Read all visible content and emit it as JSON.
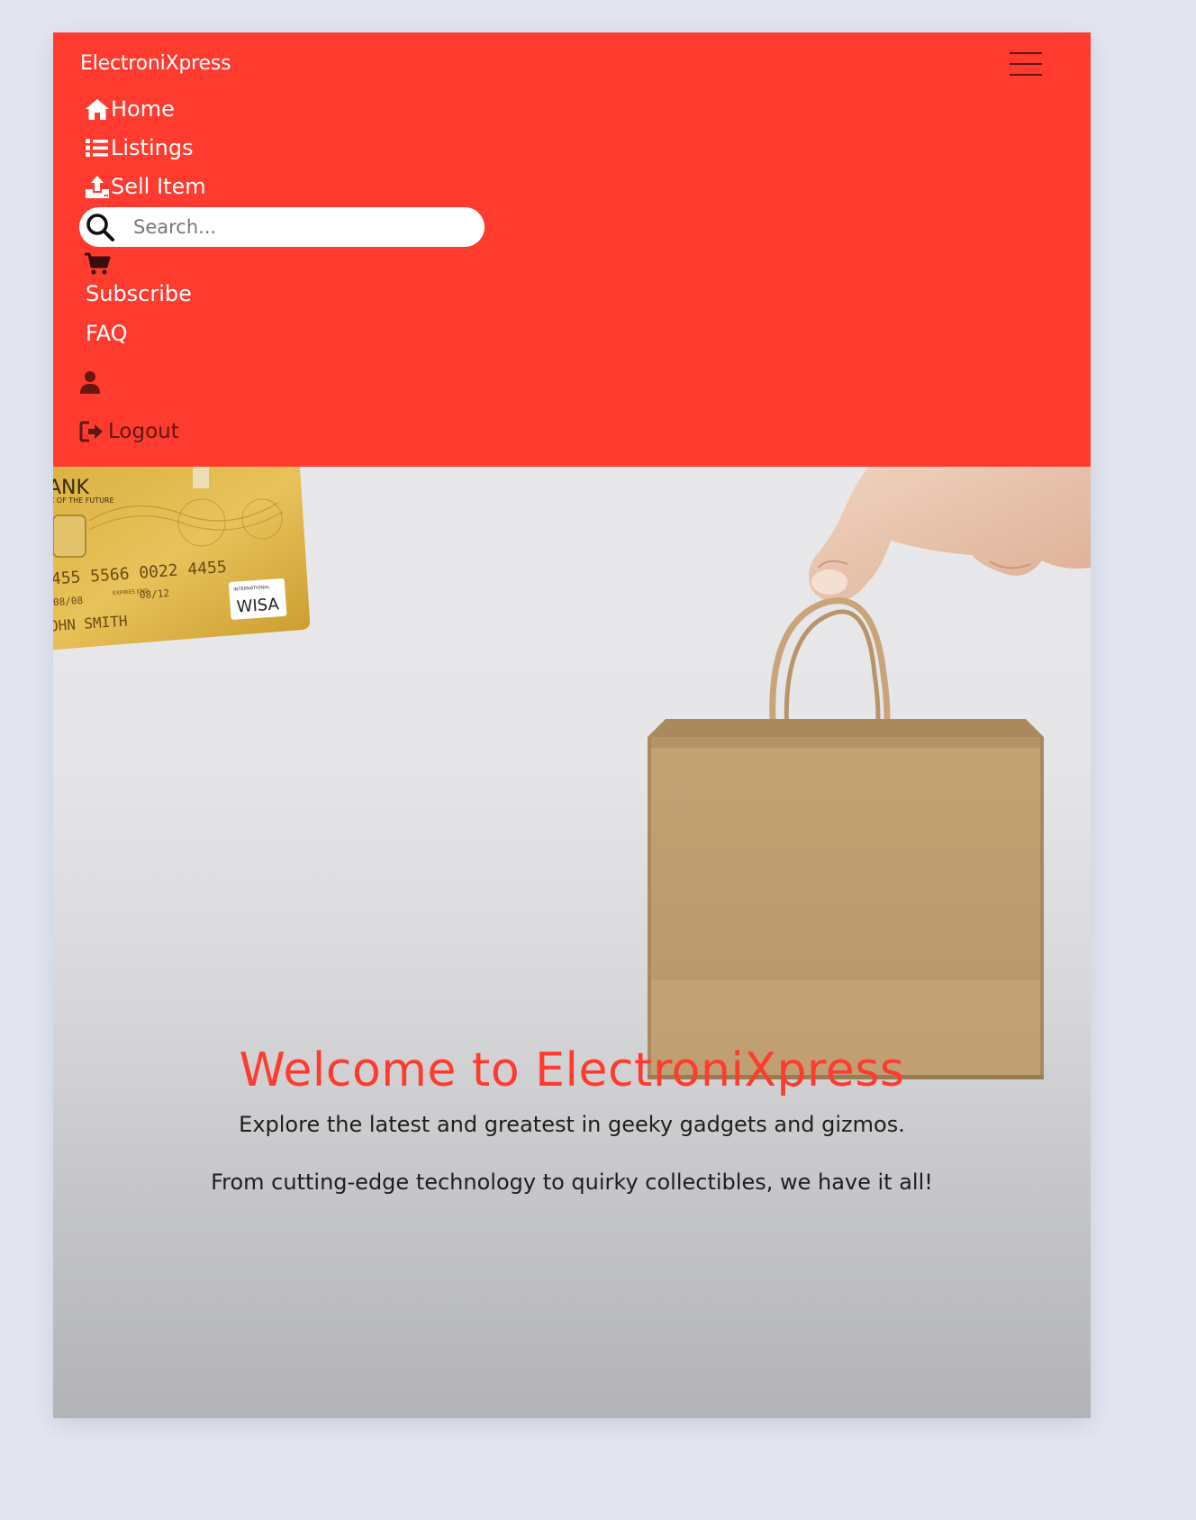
{
  "navbar": {
    "brand": "ElectroniXpress",
    "toggler_icon": "hamburger-icon",
    "links": {
      "home": "Home",
      "listings": "Listings",
      "sell": "Sell Item",
      "subscribe": "Subscribe",
      "faq": "FAQ",
      "logout": "Logout"
    },
    "icons": {
      "home": "home-icon",
      "listings": "list-icon",
      "sell": "upload-icon",
      "search": "search-icon",
      "cart": "cart-icon",
      "user": "user-icon",
      "logout": "logout-icon"
    },
    "search": {
      "placeholder": "Search...",
      "value": ""
    },
    "background_color": "#ff3b2f"
  },
  "hero": {
    "title": "Welcome to ElectroniXpress",
    "text_1": "Explore the latest and greatest in geeky gadgets and gizmos.",
    "text_2": "From cutting-edge technology to quirky collectibles, we have it all!",
    "card": {
      "bank_text": "ANK",
      "tagline": "K OF THE FUTURE",
      "number": "455 5566 0022 4455",
      "valid_from": "08/08",
      "expires": "08/12",
      "holder": "OHN SMITH",
      "network": "WISA",
      "network_small": "INTERNATIONAL",
      "expires_label": "EXPIRES END"
    },
    "title_color": "#ff3b2f"
  }
}
